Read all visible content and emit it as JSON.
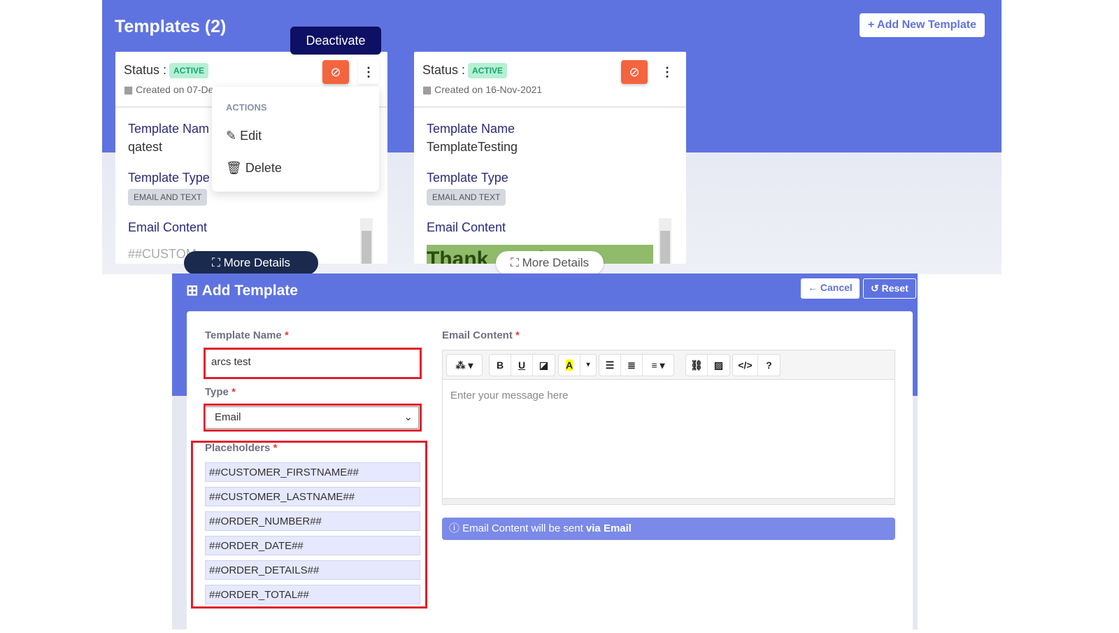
{
  "header": {
    "title": "Templates (2)",
    "add_button": "+ Add New Template"
  },
  "tooltip": "Deactivate",
  "actions_menu": {
    "heading": "ACTIONS",
    "items": [
      {
        "label": "Edit",
        "icon": "edit-icon"
      },
      {
        "label": "Delete",
        "icon": "trash-icon"
      }
    ]
  },
  "cards": [
    {
      "status_label": "Status :",
      "status": "ACTIVE",
      "created": "Created on 07-De",
      "name_label": "Template Nam",
      "name": "qatest",
      "type_label": "Template Type",
      "type": "EMAIL AND TEXT",
      "content_label": "Email Content",
      "content_preview": "##CUSTOM",
      "more": "More Details"
    },
    {
      "status_label": "Status :",
      "status": "ACTIVE",
      "created": "Created on 16-Nov-2021",
      "name_label": "Template Name",
      "name": "TemplateTesting",
      "type_label": "Template Type",
      "type": "EMAIL AND TEXT",
      "content_label": "Email Content",
      "content_preview": "Thank      rder",
      "more": "More Details"
    }
  ],
  "form": {
    "title": "Add Template",
    "cancel": "Cancel",
    "reset": "Reset",
    "name_label": "Template Name",
    "name_value": "arcs test",
    "type_label": "Type",
    "type_value": "Email",
    "placeholders_label": "Placeholders",
    "placeholders": [
      "##CUSTOMER_FIRSTNAME##",
      "##CUSTOMER_LASTNAME##",
      "##ORDER_NUMBER##",
      "##ORDER_DATE##",
      "##ORDER_DETAILS##",
      "##ORDER_TOTAL##"
    ],
    "content_label": "Email Content",
    "content_placeholder": "Enter your message here",
    "info_text": "Email Content will be sent ",
    "info_bold": "via Email"
  },
  "colors": {
    "primary": "#5f73e0",
    "danger": "#f4643f",
    "tooltip": "#0d1063",
    "active_badge": "#b6f0d4",
    "highlight": "#e11d2b"
  }
}
